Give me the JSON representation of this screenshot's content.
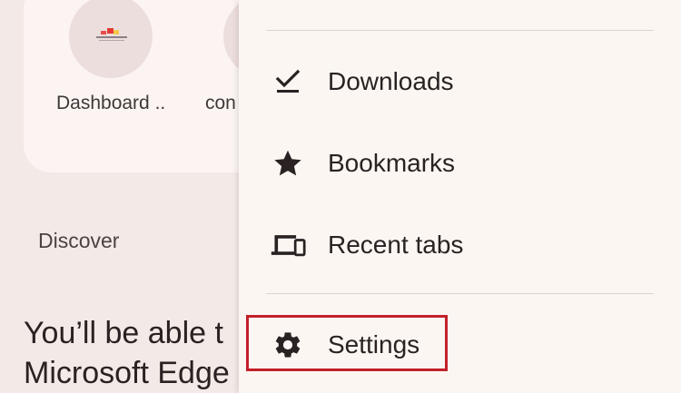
{
  "background": {
    "shortcuts": [
      {
        "label": "Dashboard ..."
      },
      {
        "label": "con"
      }
    ],
    "discover_label": "Discover",
    "discover_text_line1": "You’ll be able t",
    "discover_text_line2": "Microsoft Edge"
  },
  "menu": {
    "items": [
      {
        "label": "Downloads",
        "icon": "download-done-icon"
      },
      {
        "label": "Bookmarks",
        "icon": "star-icon"
      },
      {
        "label": "Recent tabs",
        "icon": "devices-icon"
      },
      {
        "label": "Settings",
        "icon": "gear-icon"
      }
    ],
    "highlight_color": "#c2202a"
  }
}
